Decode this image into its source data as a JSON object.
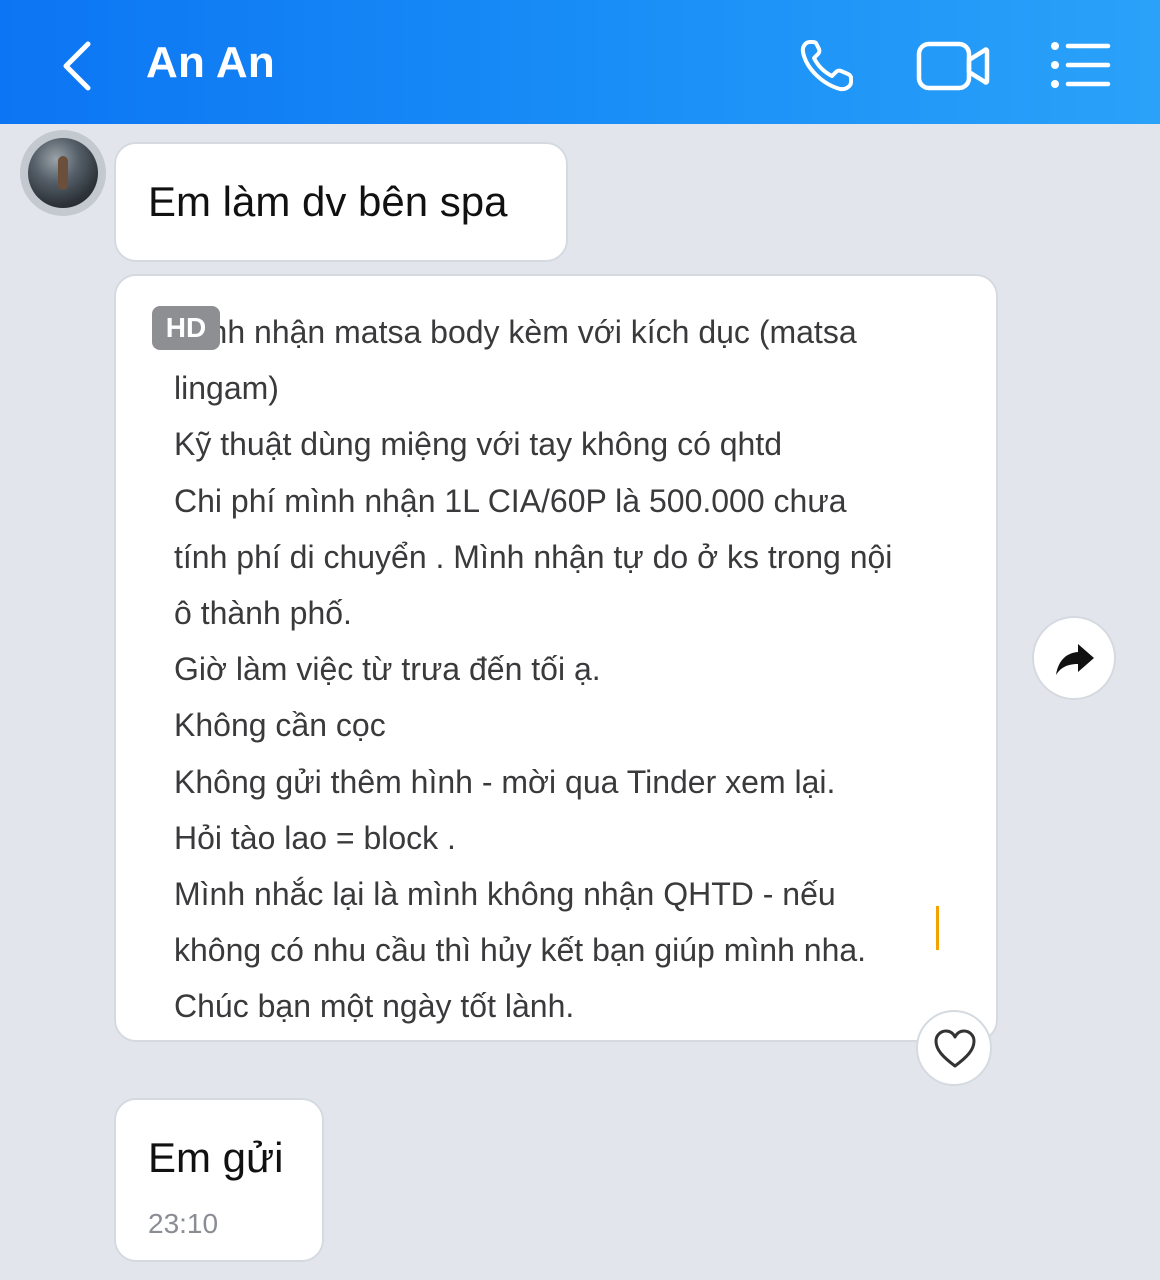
{
  "header": {
    "title": "An An",
    "back_icon": "chevron-left-icon",
    "actions": [
      {
        "name": "phone-icon"
      },
      {
        "name": "video-call-icon"
      },
      {
        "name": "menu-list-icon"
      }
    ],
    "colors": {
      "gradient_start": "#0c75f3",
      "gradient_end": "#2aa2f9"
    }
  },
  "messages": [
    {
      "type": "text",
      "text": "Em làm dv bên spa"
    },
    {
      "type": "image",
      "badge": "HD",
      "image_lines": [
        "Mình nhận matsa body kèm với kích dục (matsa",
        "lingam)",
        "Kỹ thuật dùng miệng với tay không có qhtd",
        "Chi phí mình nhận 1L CIA/60P là 500.000 chưa",
        "tính phí di chuyển . Mình nhận tự do ở ks trong nội",
        "ô thành phố.",
        "Giờ làm việc từ trưa đến tối ạ.",
        "Không cần cọc",
        "Không gửi thêm hình - mời qua Tinder xem lại.",
        "Hỏi tào lao = block .",
        "Mình nhắc lại là mình không nhận QHTD - nếu",
        "không có nhu cầu thì hủy kết bạn giúp mình nha.",
        "Chúc bạn một ngày tốt lành."
      ],
      "reaction_icon": "heart-outline-icon",
      "share_icon": "share-forward-icon"
    },
    {
      "type": "text",
      "text": "Em gửi",
      "time": "23:10"
    }
  ]
}
